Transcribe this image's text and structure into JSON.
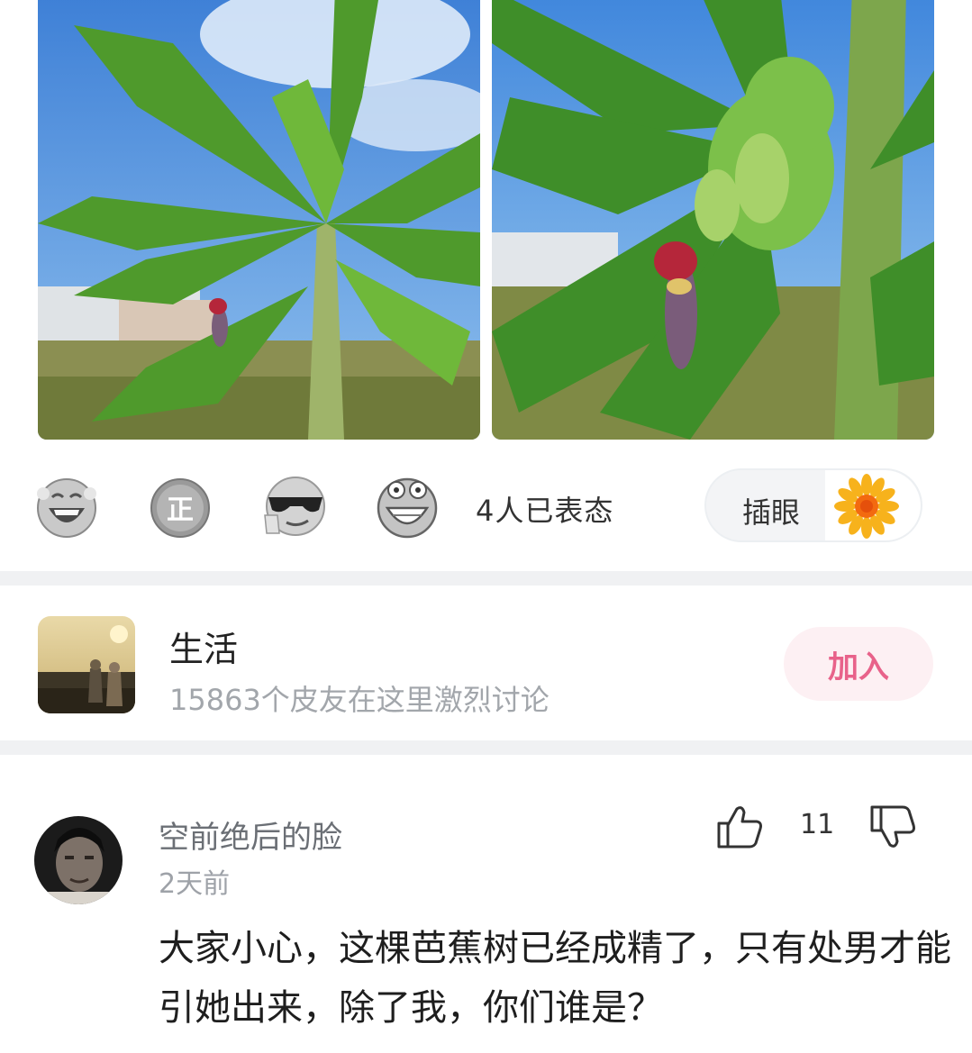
{
  "reactions": {
    "icons": [
      "laughing-emoji",
      "zheng-emoji",
      "sunglasses-emoji",
      "grinning-emoji"
    ],
    "count_label": "4人已表态"
  },
  "action": {
    "label": "插眼",
    "icon": "sunflower-icon"
  },
  "group": {
    "name": "生活",
    "subtitle": "15863个皮友在这里激烈讨论",
    "join_label": "加入",
    "accent": "#e8628a"
  },
  "comment": {
    "user": "空前绝后的脸",
    "time": "2天前",
    "like_count": "11",
    "text": "大家小心，这棵芭蕉树已经成精了，只有处男才能引她出来，除了我，你们谁是？"
  }
}
